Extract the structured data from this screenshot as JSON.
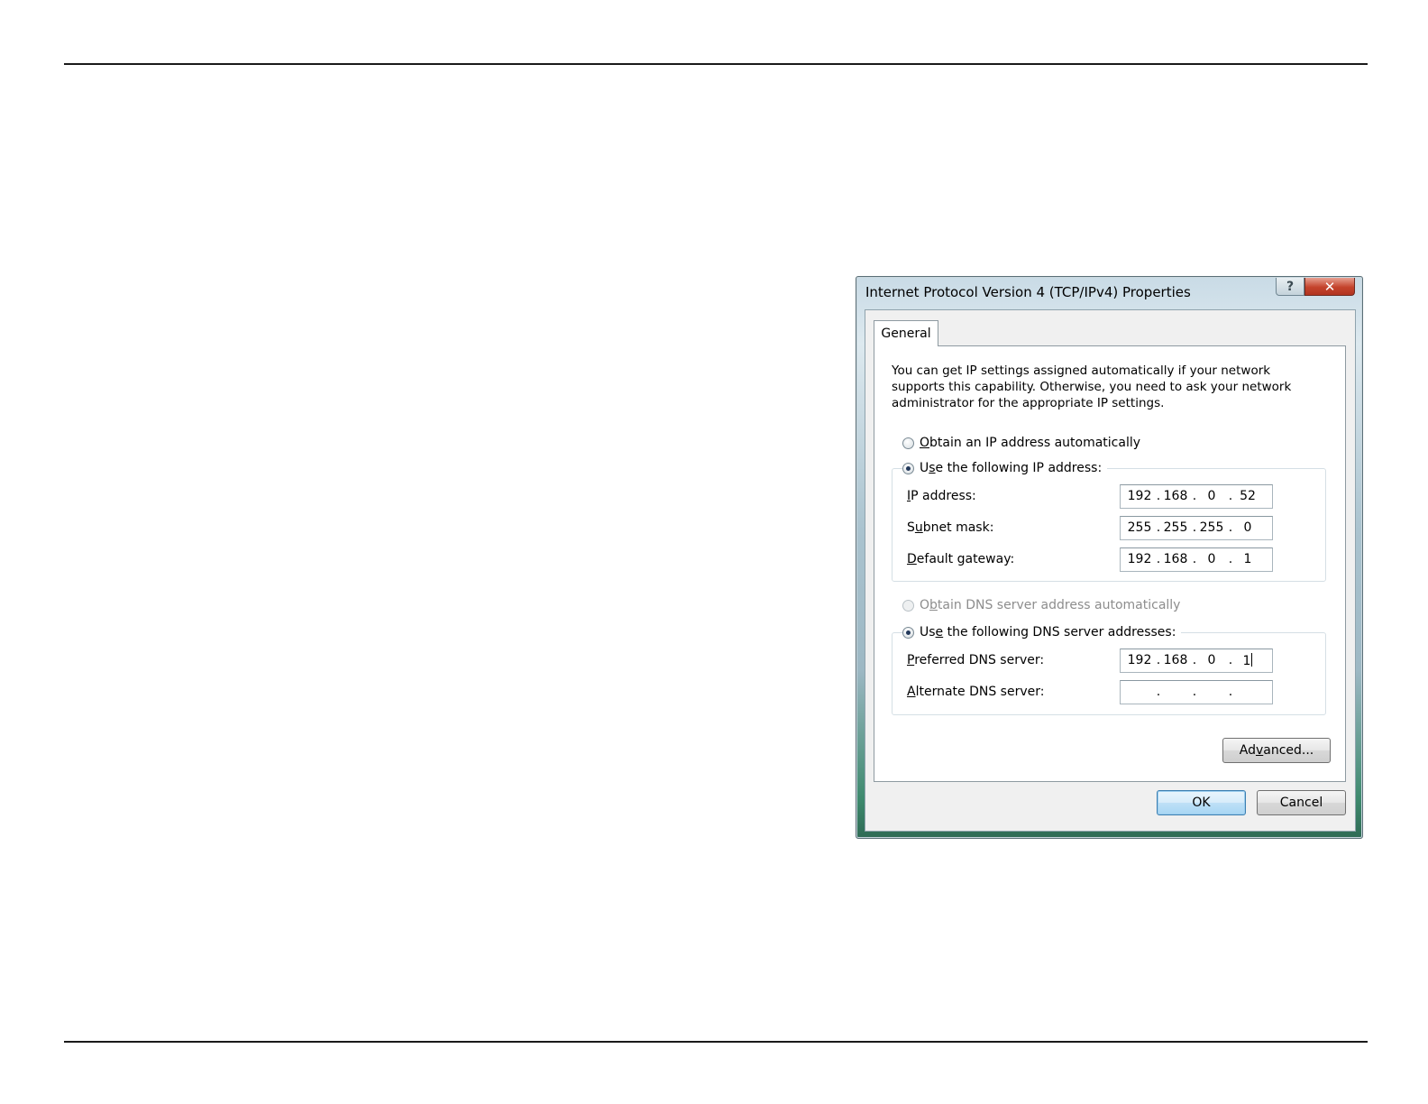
{
  "dialog": {
    "title": "Internet Protocol Version 4 (TCP/IPv4) Properties",
    "help_glyph": "?",
    "close_glyph": "✕",
    "tab_label": "General",
    "intro": "You can get IP settings assigned automatically if your network supports this capability. Otherwise, you need to ask your network administrator for the appropriate IP settings.",
    "ip_auto": {
      "pre": "",
      "key": "O",
      "post": "btain an IP address automatically"
    },
    "ip_manual": {
      "pre": "U",
      "key": "s",
      "post": "e the following IP address:"
    },
    "fields": {
      "ip": {
        "pre": "",
        "key": "I",
        "post": "P address:",
        "octets": [
          "192",
          "168",
          "0",
          "52"
        ]
      },
      "subnet": {
        "pre": "S",
        "key": "u",
        "post": "bnet mask:",
        "octets": [
          "255",
          "255",
          "255",
          "0"
        ]
      },
      "gateway": {
        "pre": "",
        "key": "D",
        "post": "efault gateway:",
        "octets": [
          "192",
          "168",
          "0",
          "1"
        ]
      }
    },
    "dns_auto": {
      "pre": "O",
      "key": "b",
      "post": "tain DNS server address automatically"
    },
    "dns_manual": {
      "pre": "Us",
      "key": "e",
      "post": " the following DNS server addresses:"
    },
    "dns_fields": {
      "preferred": {
        "pre": "",
        "key": "P",
        "post": "referred DNS server:",
        "octets": [
          "192",
          "168",
          "0",
          "1"
        ]
      },
      "alternate": {
        "pre": "",
        "key": "A",
        "post": "lternate DNS server:",
        "octets": [
          "",
          "",
          "",
          ""
        ]
      }
    },
    "octet_separator": ".",
    "advanced": {
      "pre": "Ad",
      "key": "v",
      "post": "anced..."
    },
    "ok_label": "OK",
    "cancel_label": "Cancel"
  }
}
